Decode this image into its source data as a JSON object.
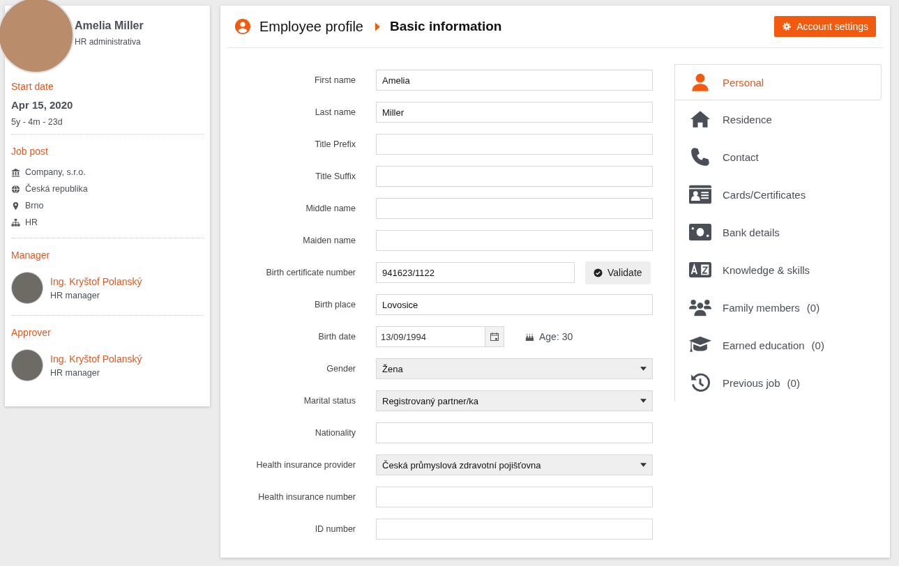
{
  "profile": {
    "name": "Amelia Miller",
    "role": "HR administrativa"
  },
  "start": {
    "heading": "Start date",
    "date": "Apr 15, 2020",
    "tenure": "5y - 4m - 23d"
  },
  "job_post": {
    "heading": "Job post",
    "items": [
      {
        "kind": "company",
        "text": "Company, s.r.o."
      },
      {
        "kind": "country",
        "text": "Česká republika"
      },
      {
        "kind": "city",
        "text": "Brno"
      },
      {
        "kind": "department",
        "text": "HR"
      }
    ]
  },
  "people": [
    {
      "heading": "Manager",
      "name": "Ing. Kryštof Polanský",
      "role": "HR manager"
    },
    {
      "heading": "Approver",
      "name": "Ing. Kryštof Polanský",
      "role": "HR manager"
    }
  ],
  "breadcrumb": {
    "parent": "Employee profile",
    "current": "Basic information"
  },
  "account_button": "Account settings",
  "form": [
    {
      "kind": "text",
      "label": "First name",
      "value": "Amelia"
    },
    {
      "kind": "text",
      "label": "Last name",
      "value": "Miller"
    },
    {
      "kind": "text",
      "label": "Title Prefix"
    },
    {
      "kind": "text",
      "label": "Title Suffix"
    },
    {
      "kind": "text",
      "label": "Middle name"
    },
    {
      "kind": "text",
      "label": "Maiden name"
    },
    {
      "kind": "validate",
      "label": "Birth certificate number",
      "value": "941623/1122",
      "button": "Validate"
    },
    {
      "kind": "text",
      "label": "Birth place",
      "value": "Lovosice"
    },
    {
      "kind": "date",
      "label": "Birth date",
      "value": "13/09/1994",
      "age": "Age: 30"
    },
    {
      "kind": "select",
      "label": "Gender",
      "value": "Žena"
    },
    {
      "kind": "select",
      "label": "Marital status",
      "value": "Registrovaný partner/ka"
    },
    {
      "kind": "text",
      "label": "Nationality"
    },
    {
      "kind": "select",
      "label": "Health insurance provider",
      "value": "Česká průmyslová zdravotní pojišťovna"
    },
    {
      "kind": "text",
      "label": "Health insurance number"
    },
    {
      "kind": "text",
      "label": "ID number"
    }
  ],
  "sections": [
    {
      "kind": "person",
      "label": "Personal",
      "selected": true
    },
    {
      "kind": "home",
      "label": "Residence",
      "selected": false
    },
    {
      "kind": "phone",
      "label": "Contact",
      "selected": false
    },
    {
      "kind": "card",
      "label": "Cards/Certificates",
      "selected": false
    },
    {
      "kind": "money",
      "label": "Bank details",
      "selected": false
    },
    {
      "kind": "language",
      "label": "Knowledge & skills",
      "selected": false
    },
    {
      "kind": "family",
      "label": "Family members",
      "count": "(0)",
      "selected": false
    },
    {
      "kind": "education",
      "label": "Earned education",
      "count": "(0)",
      "selected": false
    },
    {
      "kind": "history",
      "label": "Previous job",
      "count": "(0)",
      "selected": false
    }
  ]
}
